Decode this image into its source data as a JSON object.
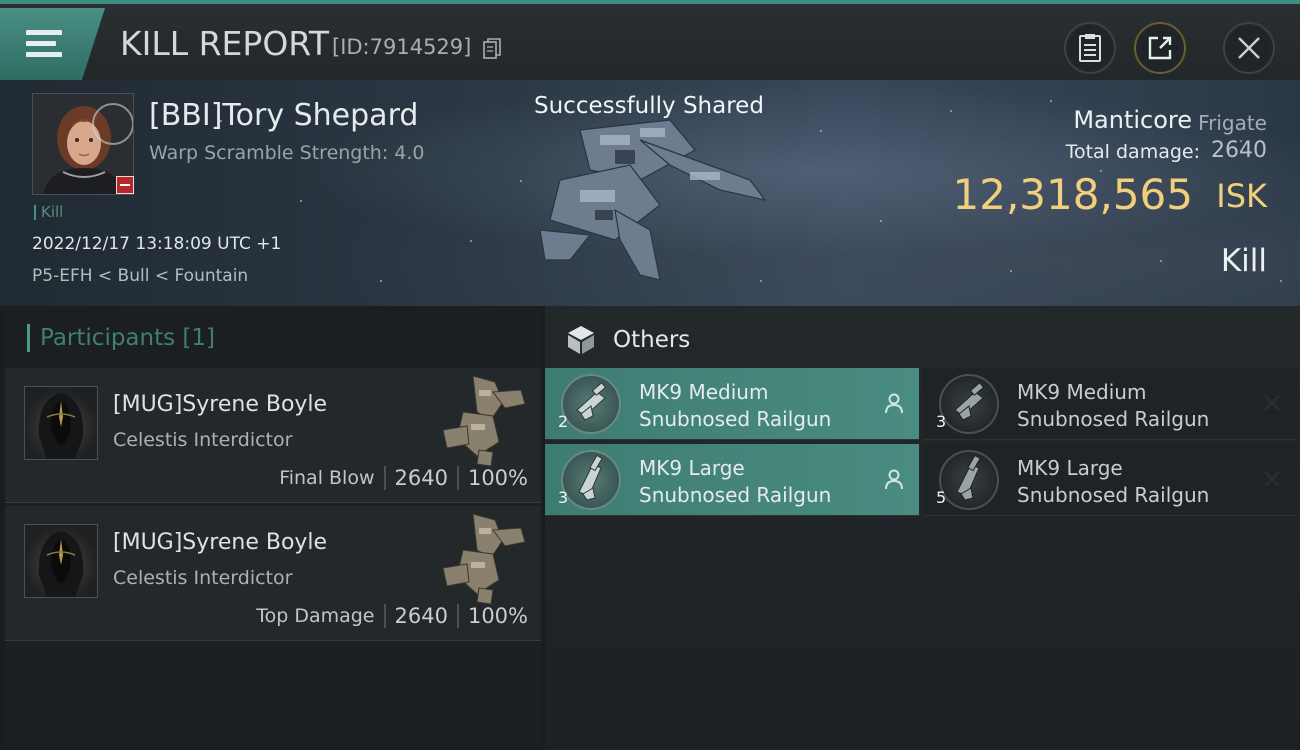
{
  "header": {
    "title": "KILL REPORT",
    "report_id": "[ID:7914529]",
    "menu_icon": "hamburger-menu-icon",
    "report_icon": "clipboard-icon",
    "share_icon": "share-export-icon",
    "close_icon": "close-icon"
  },
  "victim": {
    "name": "[BBI]Tory Shepard",
    "warp_scramble": "Warp Scramble Strength: 4.0",
    "tag": "Kill",
    "datetime": "2022/12/17 13:18:09 UTC +1",
    "location": "P5-EFH < Bull < Fountain",
    "ship_name": "Manticore",
    "ship_class": "Frigate",
    "total_damage_label": "Total damage:",
    "total_damage": "2640",
    "isk_value": "12,318,565",
    "isk_unit": "ISK",
    "result": "Kill"
  },
  "toast": "Successfully Shared",
  "participants": {
    "heading": "Participants",
    "count": "[1]",
    "rows": [
      {
        "name": "[MUG]Syrene Boyle",
        "ship": "Celestis Interdictor",
        "role": "Final Blow",
        "damage": "2640",
        "percent": "100%"
      },
      {
        "name": "[MUG]Syrene Boyle",
        "ship": "Celestis Interdictor",
        "role": "Top Damage",
        "damage": "2640",
        "percent": "100%"
      }
    ]
  },
  "others": {
    "heading": "Others",
    "items": [
      {
        "qty": "2",
        "line1": "MK9 Medium",
        "line2": "Snubnosed Railgun",
        "status": "dropped"
      },
      {
        "qty": "3",
        "line1": "MK9 Medium",
        "line2": "Snubnosed Railgun",
        "status": "destroyed"
      },
      {
        "qty": "3",
        "line1": "MK9 Large",
        "line2": "Snubnosed Railgun",
        "status": "dropped"
      },
      {
        "qty": "5",
        "line1": "MK9 Large",
        "line2": "Snubnosed Railgun",
        "status": "destroyed"
      }
    ]
  },
  "colors": {
    "accent": "#4a8f84",
    "isk_gold": "#f1cf7d",
    "dropped_row": "#4a8c81"
  }
}
